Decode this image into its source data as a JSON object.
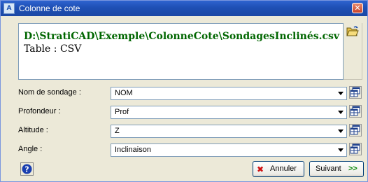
{
  "window": {
    "title": "Colonne de cote",
    "icon": "app-icon",
    "close_icon": "close-icon"
  },
  "source": {
    "path": "D:\\StratiCAD\\Exemple\\ColonneCote\\SondagesInclinés.csv",
    "table": "Table : CSV",
    "path_color": "#006600"
  },
  "fields": [
    {
      "label": "Nom de sondage :",
      "value": "NOM"
    },
    {
      "label": "Profondeur :",
      "value": "Prof"
    },
    {
      "label": "Altitude :",
      "value": "Z"
    },
    {
      "label": "Angle :",
      "value": "Inclinaison"
    }
  ],
  "buttons": {
    "cancel": "Annuler",
    "next": "Suivant",
    "next_arrows": ">>"
  },
  "icons": {
    "folder": "open-folder-icon",
    "help": "help-icon",
    "table_browse": "table-grid-icon",
    "cancel": "red-x-icon",
    "dropdown": "chevron-down-icon"
  }
}
